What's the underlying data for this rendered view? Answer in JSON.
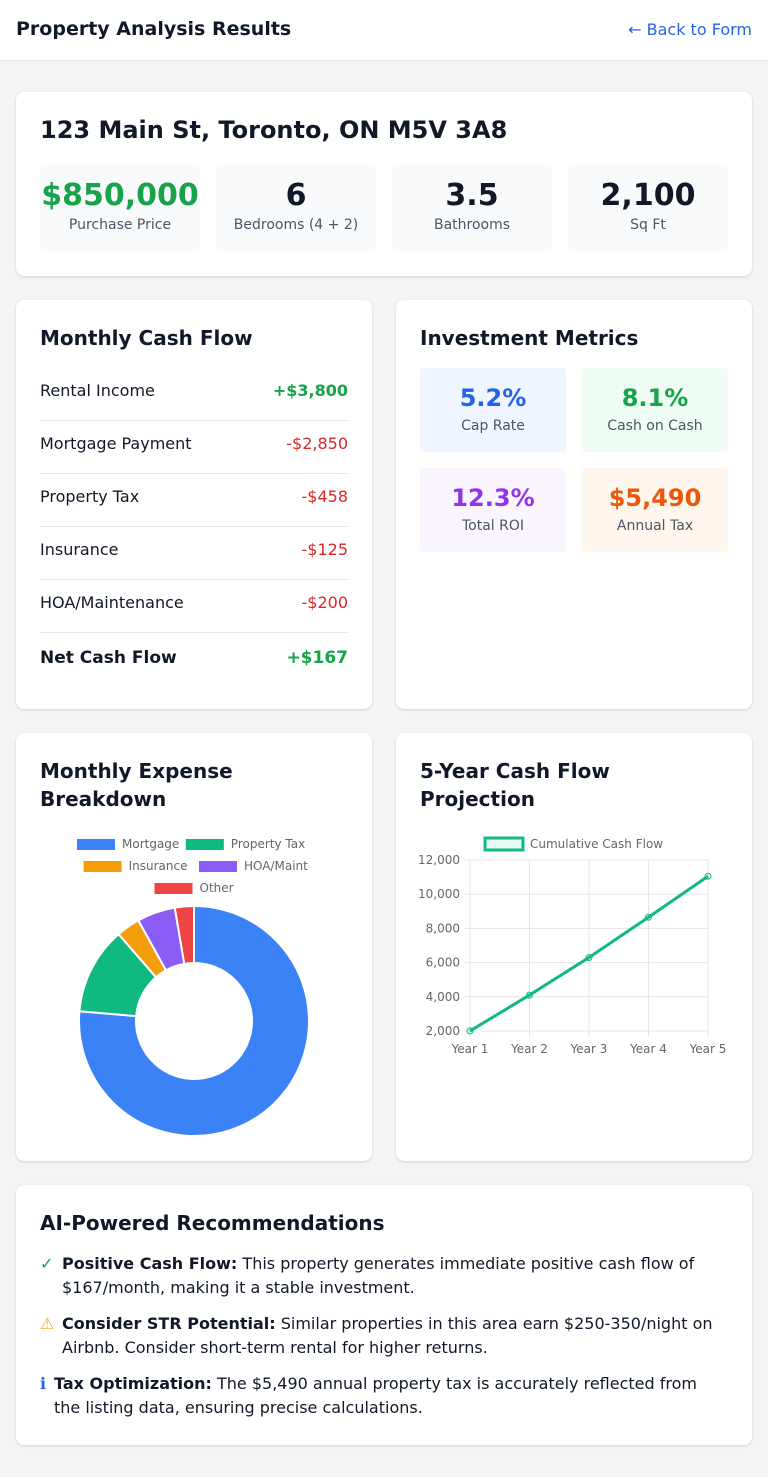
{
  "header": {
    "title": "Property Analysis Results",
    "back_link": "← Back to Form"
  },
  "property": {
    "address": "123 Main St, Toronto, ON M5V 3A8",
    "stats": [
      {
        "value": "$850,000",
        "label": "Purchase Price"
      },
      {
        "value": "6",
        "label": "Bedrooms (4 + 2)"
      },
      {
        "value": "3.5",
        "label": "Bathrooms"
      },
      {
        "value": "2,100",
        "label": "Sq Ft"
      }
    ]
  },
  "cash_flow": {
    "title": "Monthly Cash Flow",
    "rows": [
      {
        "label": "Rental Income",
        "value": "+$3,800"
      },
      {
        "label": "Mortgage Payment",
        "value": "-$2,850"
      },
      {
        "label": "Property Tax",
        "value": "-$458"
      },
      {
        "label": "Insurance",
        "value": "-$125"
      },
      {
        "label": "HOA/Maintenance",
        "value": "-$200"
      }
    ],
    "net": {
      "label": "Net Cash Flow",
      "value": "+$167"
    }
  },
  "metrics": {
    "title": "Investment Metrics",
    "items": [
      {
        "value": "5.2%",
        "label": "Cap Rate",
        "color": "#2563eb",
        "bg": "#eff6ff"
      },
      {
        "value": "8.1%",
        "label": "Cash on Cash",
        "color": "#16a34a",
        "bg": "#f0fdf4"
      },
      {
        "value": "12.3%",
        "label": "Total ROI",
        "color": "#9333ea",
        "bg": "#faf5ff"
      },
      {
        "value": "$5,490",
        "label": "Annual Tax",
        "color": "#ea580c",
        "bg": "#fff7ed"
      }
    ]
  },
  "expense_chart": {
    "title": "Monthly Expense Breakdown",
    "chart_data": {
      "type": "pie",
      "style": "doughnut",
      "categories": [
        "Mortgage",
        "Property Tax",
        "Insurance",
        "HOA/Maint",
        "Other"
      ],
      "values": [
        2850,
        458,
        125,
        200,
        100
      ],
      "colors": [
        "#3b82f6",
        "#10b981",
        "#f59e0b",
        "#8b5cf6",
        "#ef4444"
      ],
      "legend": "top"
    }
  },
  "projection_chart": {
    "title": "5-Year Cash Flow Projection",
    "chart_data": {
      "type": "line",
      "x": [
        "Year 1",
        "Year 2",
        "Year 3",
        "Year 4",
        "Year 5"
      ],
      "series": [
        {
          "name": "Cumulative Cash Flow",
          "values": [
            2004,
            4100,
            6300,
            8650,
            11050
          ],
          "color": "#10b981"
        }
      ],
      "ylim": [
        2000,
        12000
      ],
      "yticks": [
        2000,
        4000,
        6000,
        8000,
        10000,
        12000
      ],
      "ytick_labels": [
        "2,000",
        "4,000",
        "6,000",
        "8,000",
        "10,000",
        "12,000"
      ],
      "grid": true,
      "legend": "top"
    }
  },
  "recommendations": {
    "title": "AI-Powered Recommendations",
    "items": [
      {
        "icon": "✓",
        "icon_name": "check-icon",
        "icon_color": "#16a34a",
        "heading": "Positive Cash Flow:",
        "text": " This property generates immediate positive cash flow of $167/month, making it a stable investment."
      },
      {
        "icon": "⚠",
        "icon_name": "warning-icon",
        "icon_color": "#eab308",
        "heading": "Consider STR Potential:",
        "text": " Similar properties in this area earn $250-350/night on Airbnb. Consider short-term rental for higher returns."
      },
      {
        "icon": "ℹ",
        "icon_name": "info-icon",
        "icon_color": "#2563eb",
        "heading": "Tax Optimization:",
        "text": " The $5,490 annual property tax is accurately reflected from the listing data, ensuring precise calculations."
      }
    ]
  }
}
